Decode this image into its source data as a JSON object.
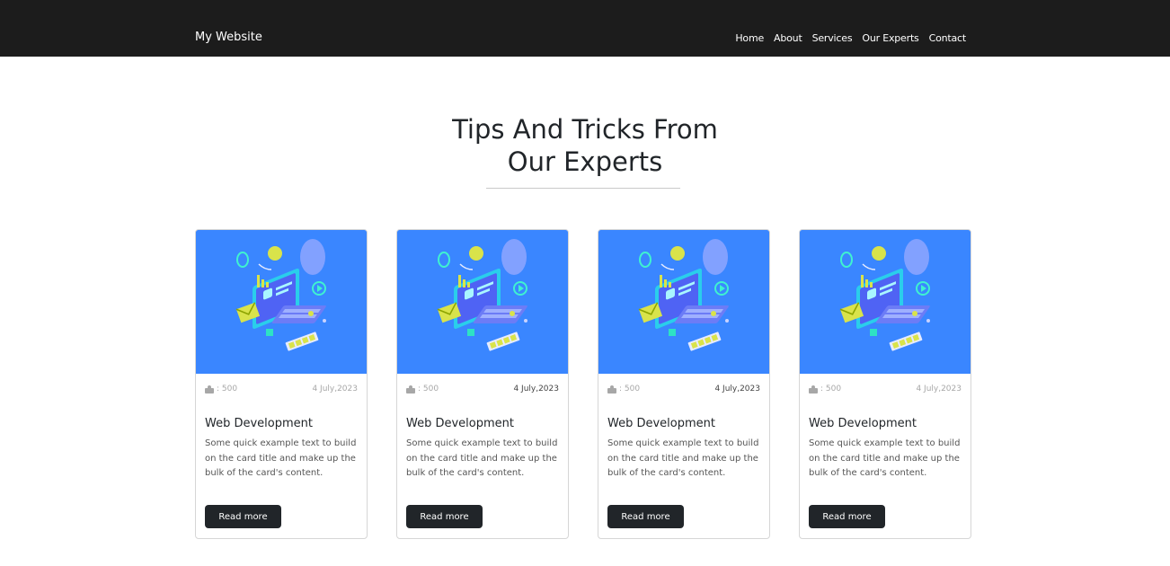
{
  "navbar": {
    "brand": "My Website",
    "links": [
      "Home",
      "About",
      "Services",
      "Our Experts",
      "Contact"
    ]
  },
  "section": {
    "title_line1": "Tips And Tricks From",
    "title_line2": "Our Experts"
  },
  "cards": [
    {
      "likes": ": 500",
      "date": "4 July,2023",
      "title": "Web Development",
      "text": "Some quick example text to build on the card title and make up the bulk of the card's content.",
      "button": "Read more"
    },
    {
      "likes": ": 500",
      "date": "4 July,2023",
      "title": "Web Development",
      "text": "Some quick example text to build on the card title and make up the bulk of the card's content.",
      "button": "Read more"
    },
    {
      "likes": ": 500",
      "date": "4 July,2023",
      "title": "Web Development",
      "text": "Some quick example text to build on the card title and make up the bulk of the card's content.",
      "button": "Read more"
    },
    {
      "likes": ": 500",
      "date": "4 July,2023",
      "title": "Web Development",
      "text": "Some quick example text to build on the card title and make up the bulk of the card's content.",
      "button": "Read more"
    }
  ],
  "colors": {
    "navbar": "#1c1c1c",
    "card_image_bg": "#3a86ff",
    "button": "#212529"
  }
}
